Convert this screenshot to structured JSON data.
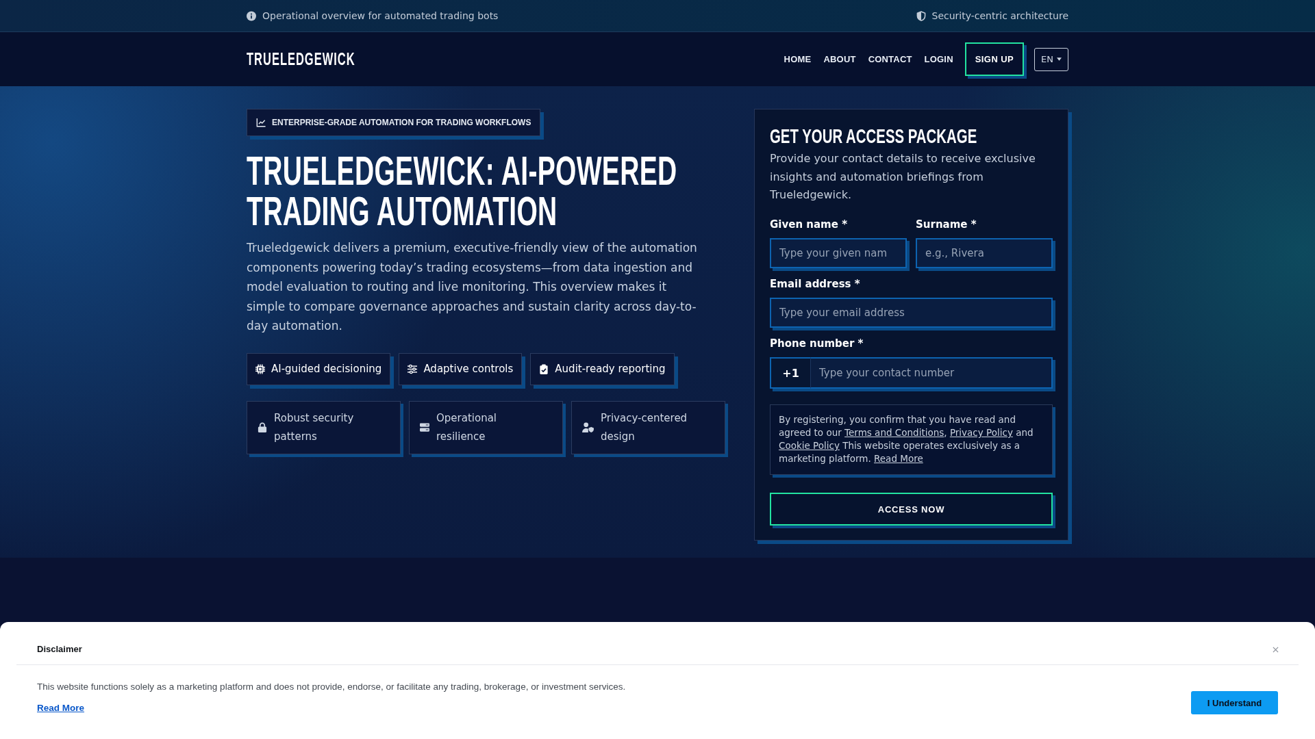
{
  "top_bar": {
    "info": "Operational overview for automated trading bots",
    "security": "Security-centric architecture"
  },
  "nav": {
    "logo": "TRUELEDGEWICK",
    "links": [
      "HOME",
      "ABOUT",
      "CONTACT",
      "LOGIN"
    ],
    "signup": "SIGN UP",
    "language": "EN"
  },
  "hero": {
    "badge": "ENTERPRISE-GRADE AUTOMATION FOR TRADING WORKFLOWS",
    "title": "TRUELEDGEWICK: AI-POWERED TRADING AUTOMATION",
    "description": "Trueledgewick delivers a premium, executive-friendly view of the automation components powering today’s trading ecosystems—from data ingestion and model evaluation to routing and live monitoring. This overview makes it simple to compare governance approaches and sustain clarity across day-to-day automation.",
    "highlights": [
      "AI-guided decisioning",
      "Adaptive controls",
      "Audit-ready reporting"
    ],
    "features": [
      "Robust security patterns",
      "Operational resilience",
      "Privacy-centered design"
    ]
  },
  "form": {
    "title": "GET YOUR ACCESS PACKAGE",
    "description": "Provide your contact details to receive exclusive insights and automation briefings from Trueledgewick.",
    "rows": [
      [
        {
          "label": "Given name *",
          "placeholder": "Type your given nam"
        },
        {
          "label": "Surname *",
          "placeholder": "e.g., Rivera"
        }
      ],
      [
        {
          "label": "Email address *",
          "placeholder": "Type your email address"
        }
      ],
      [
        {
          "label": "Phone number *",
          "prefix": "+1",
          "placeholder": "Type your contact number"
        }
      ]
    ],
    "consent": [
      {
        "kind": "text",
        "text": "By registering, you confirm that you have read and agreed to our "
      },
      {
        "kind": "link",
        "text": "Terms and Conditions"
      },
      {
        "kind": "text",
        "text": ", "
      },
      {
        "kind": "link",
        "text": "Privacy Policy"
      },
      {
        "kind": "text",
        "text": " and "
      },
      {
        "kind": "link",
        "text": "Cookie Policy"
      },
      {
        "kind": "text",
        "text": " This website operates exclusively as a marketing platform. "
      },
      {
        "kind": "link",
        "text": "Read More"
      }
    ],
    "submit": "ACCESS NOW"
  },
  "disclaimer": {
    "title": "Disclaimer",
    "text": "This website functions solely as a marketing platform and does not provide, endorse, or facilitate any trading, brokerage, or investment services.",
    "link": "Read More",
    "button": "I Understand"
  }
}
